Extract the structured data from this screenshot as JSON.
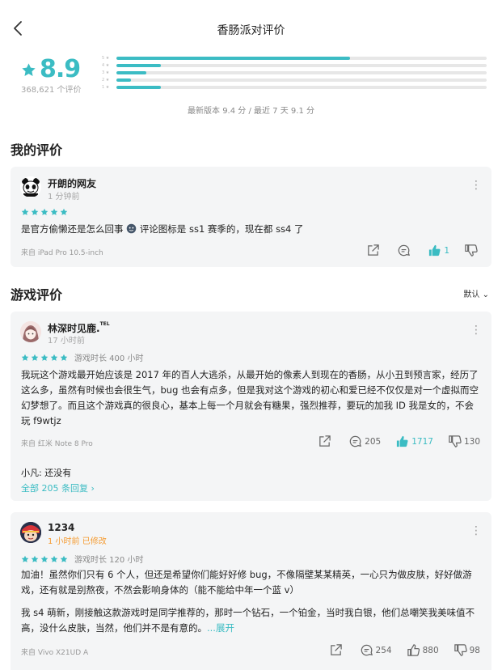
{
  "header": {
    "title": "香肠派对评价"
  },
  "rating": {
    "score": "8.9",
    "count": "368,621 个评价",
    "distribution": [
      {
        "label": "5 ★",
        "fraction": 0.63
      },
      {
        "label": "4 ★",
        "fraction": 0.12
      },
      {
        "label": "3 ★",
        "fraction": 0.08
      },
      {
        "label": "2 ★",
        "fraction": 0.04
      },
      {
        "label": "1 ★",
        "fraction": 0.12
      }
    ],
    "version_line": "最新版本 9.4 分 / 最近 7 天 9.1 分"
  },
  "my_review_section": {
    "title": "我的评价"
  },
  "my_review": {
    "name": "开朗的网友",
    "time": "1 分钟前",
    "stars": 5,
    "text_before": "是官方偷懒还是怎么回事",
    "text_after": "评论图标是 ss1 赛季的，现在都 ss4 了",
    "device": "来自 iPad Pro 10.5-inch",
    "likes": "1"
  },
  "game_reviews_section": {
    "title": "游戏评价",
    "sort_label": "默认"
  },
  "reviews": [
    {
      "name": "林深时见鹿.",
      "tag": "TEL",
      "time": "17 小时前",
      "stars": 5,
      "playtime": "游戏时长 400 小时",
      "text": "我玩这个游戏最开始应该是 2017 年的百人大逃杀，从最开始的像素人到现在的香肠，从小丑到预言家，经历了这么多，虽然有时候也会很生气，bug 也会有点多，但是我对这个游戏的初心和爱已经不仅仅是对一个虚拟而空幻梦想了。而且这个游戏真的很良心，基本上每一个月就会有糖果，强烈推荐，要玩的加我 ID 我是女的，不会玩 f9wtjz",
      "device": "来自 红米 Note 8 Pro",
      "comments": "205",
      "likes": "1717",
      "dislikes": "130",
      "reply_preview": "小凡: 还没有",
      "all_replies": "全部 205 条回复 ›"
    },
    {
      "name": "1234",
      "time": "1 小时前",
      "edited": "已修改",
      "stars": 5,
      "playtime": "游戏时长 120 小时",
      "text1": "加油！虽然你们只有 6 个人，但还是希望你们能好好修 bug，不像隔壁某某精英，一心只为做皮肤，好好做游戏，还有就是别熬夜，不然会影响身体的（能不能给中年一个蓝 v）",
      "text2": "我 s4 萌新，刚接触这款游戏时是同学推荐的，那时一个钻石，一个铂金，当时我白银，他们总嘲笑我美味值不高，没什么皮肤，当然，他们并不是有意的。",
      "expand_label": "...展开",
      "device": "来自 Vivo X21UD A",
      "comments": "254",
      "likes": "880",
      "dislikes": "98"
    }
  ],
  "colors": {
    "accent": "#3bbcc3",
    "edited": "#f59b30"
  }
}
